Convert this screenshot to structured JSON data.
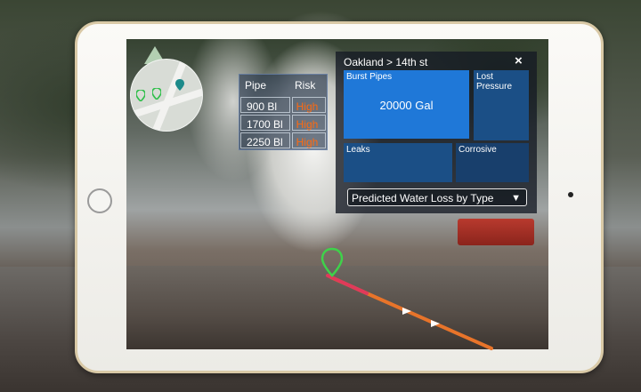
{
  "minimap": {
    "markers": [
      "map-pin-green",
      "map-pin-green",
      "map-pin-teal"
    ]
  },
  "risk_table": {
    "headers": {
      "pipe": "Pipe",
      "risk": "Risk"
    },
    "rows": [
      {
        "pipe": "900 Bl",
        "risk": "High"
      },
      {
        "pipe": "1700 Bl",
        "risk": "High"
      },
      {
        "pipe": "2250 Bl",
        "risk": "High"
      }
    ],
    "risk_color": "#ff6a10"
  },
  "panel": {
    "breadcrumb": "Oakland > 14th st",
    "close_icon": "×",
    "tiles": {
      "burst_pipes": {
        "label": "Burst Pipes",
        "value": "20000 Gal"
      },
      "lost_pressure": {
        "label": "Lost Pressure"
      },
      "leaks": {
        "label": "Leaks"
      },
      "corrosive": {
        "label": "Corrosive"
      }
    },
    "dropdown": {
      "selected": "Predicted Water Loss by Type",
      "arrow": "▼"
    }
  },
  "colors": {
    "accent_blue": "#1f78d8",
    "pin_green": "#3ed24a",
    "path_orange": "#e8742a"
  }
}
